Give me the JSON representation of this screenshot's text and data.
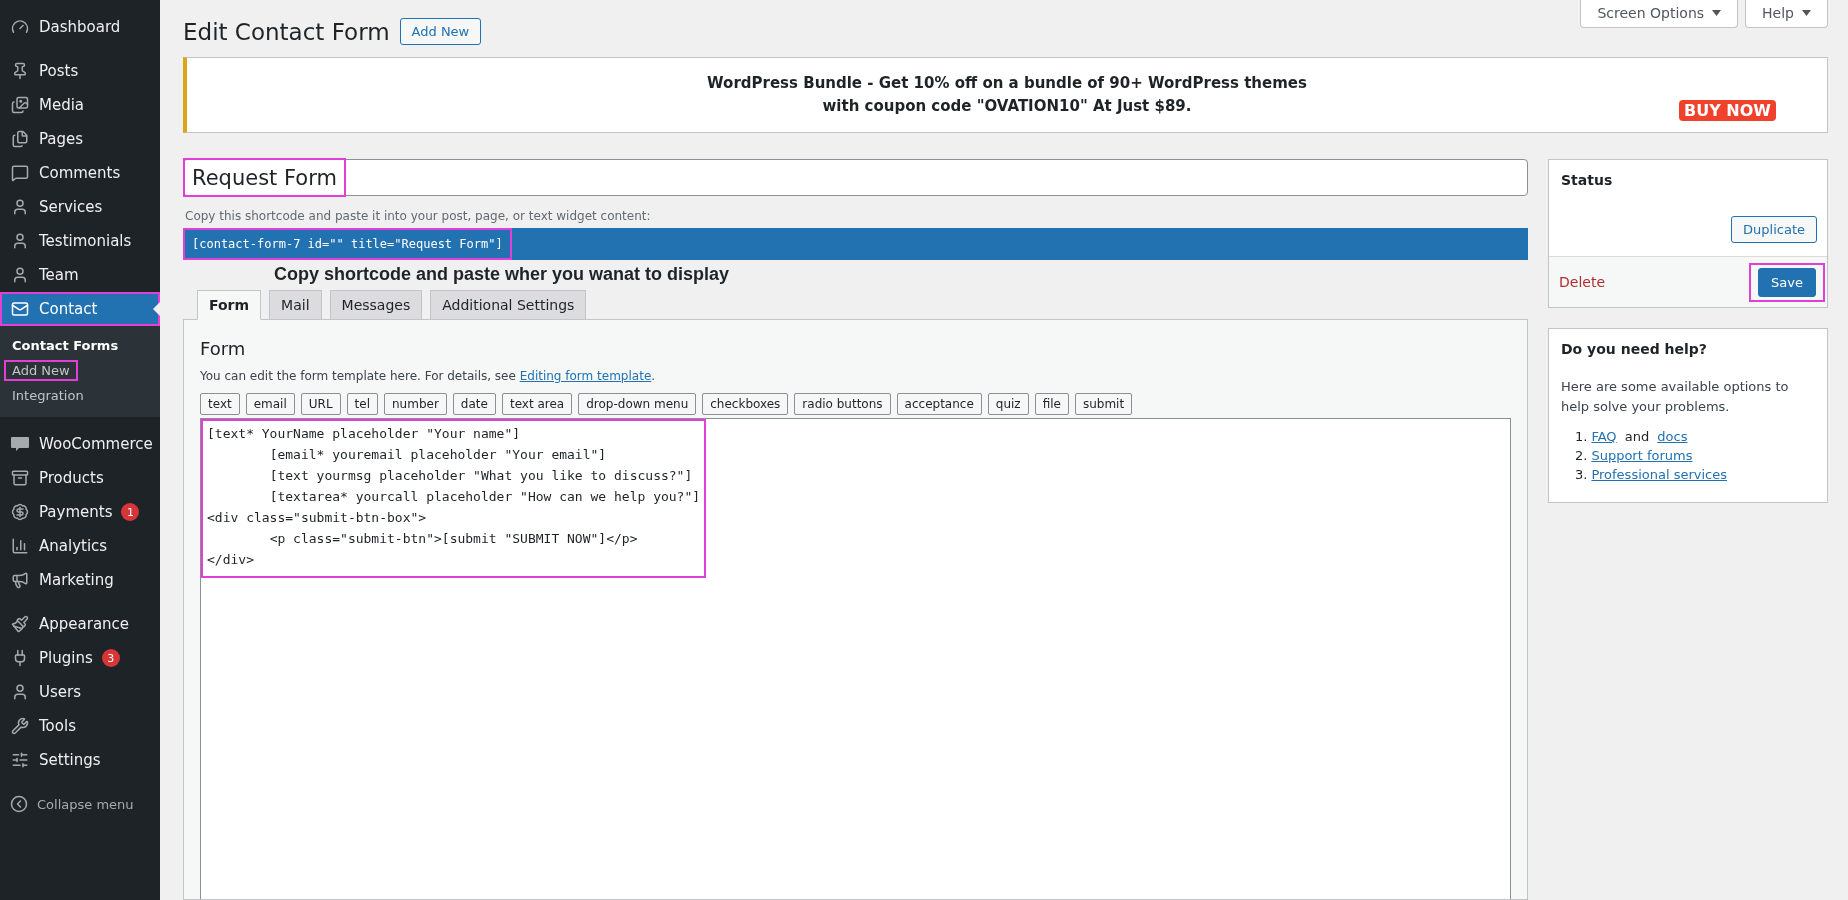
{
  "sidebar": {
    "sections": [
      [
        {
          "label": "Dashboard",
          "selected": false,
          "highlighted": false
        }
      ],
      [
        {
          "label": "Posts",
          "selected": false,
          "highlighted": false
        },
        {
          "label": "Media",
          "selected": false,
          "highlighted": false
        },
        {
          "label": "Pages",
          "selected": false,
          "highlighted": false
        },
        {
          "label": "Comments",
          "selected": false,
          "highlighted": false
        },
        {
          "label": "Services",
          "selected": false,
          "highlighted": false
        },
        {
          "label": "Testimonials",
          "selected": false,
          "highlighted": false
        },
        {
          "label": "Team",
          "selected": false,
          "highlighted": false
        },
        {
          "label": "Contact",
          "selected": true,
          "highlighted": true,
          "children": [
            {
              "label": "Contact Forms",
              "selected": true,
              "highlighted": false
            },
            {
              "label": "Add New",
              "selected": false,
              "highlighted": true
            },
            {
              "label": "Integration",
              "selected": false,
              "highlighted": false
            }
          ]
        }
      ],
      [
        {
          "label": "WooCommerce",
          "selected": false,
          "highlighted": false
        },
        {
          "label": "Products",
          "selected": false,
          "highlighted": false
        },
        {
          "label": "Payments",
          "selected": false,
          "highlighted": false,
          "badge": "1"
        },
        {
          "label": "Analytics",
          "selected": false,
          "highlighted": false
        },
        {
          "label": "Marketing",
          "selected": false,
          "highlighted": false
        }
      ],
      [
        {
          "label": "Appearance",
          "selected": false,
          "highlighted": false
        },
        {
          "label": "Plugins",
          "selected": false,
          "highlighted": false,
          "badge": "3"
        },
        {
          "label": "Users",
          "selected": false,
          "highlighted": false
        },
        {
          "label": "Tools",
          "selected": false,
          "highlighted": false
        },
        {
          "label": "Settings",
          "selected": false,
          "highlighted": false
        }
      ]
    ],
    "collapse": "Collapse menu"
  },
  "top_tabs": [
    "Screen Options",
    "Help"
  ],
  "page_title": "Edit Contact Form",
  "add_new": "Add New",
  "banner": {
    "lines": [
      "WordPress Bundle - Get 10% off on a bundle of 90+ WordPress themes",
      "with coupon code \"OVATION10\" At Just $89."
    ],
    "button": "BUY NOW"
  },
  "title_field": {
    "value": "Request Form",
    "highlighted": true
  },
  "shortcode": {
    "hint": "Copy this shortcode and paste it into your post, page, or text widget content:",
    "code": "[contact-form-7 id=\"\" title=\"Request Form\"]",
    "highlighted": true
  },
  "annotation": "Copy shortcode and paste wher you wanat to display",
  "tabs": [
    {
      "label": "Form",
      "selected": true
    },
    {
      "label": "Mail",
      "selected": false
    },
    {
      "label": "Messages",
      "selected": false
    },
    {
      "label": "Additional Settings",
      "selected": false
    }
  ],
  "form_panel": {
    "heading": "Form",
    "description": [
      {
        "text": "You can edit the form template here. For details, see ",
        "link": false
      },
      {
        "text": "Editing form template",
        "link": true
      },
      {
        "text": ".",
        "link": false
      }
    ],
    "tag_buttons": [
      "text",
      "email",
      "URL",
      "tel",
      "number",
      "date",
      "text area",
      "drop-down menu",
      "checkboxes",
      "radio buttons",
      "acceptance",
      "quiz",
      "file",
      "submit"
    ],
    "code": "[text* YourName placeholder \"Your name\"]\n\t[email* youremail placeholder \"Your email\"]\n\t[text yourmsg placeholder \"What you like to discuss?\"]\n\t[textarea* yourcall placeholder \"How can we help you?\"]\n<div class=\"submit-btn-box\">\n\t<p class=\"submit-btn\">[submit \"SUBMIT NOW\"]</p>\n</div>",
    "code_highlighted": true
  },
  "status_box": {
    "title": "Status",
    "duplicate": "Duplicate",
    "delete": "Delete",
    "save": "Save",
    "save_highlighted": true
  },
  "help_box": {
    "title": "Do you need help?",
    "intro": "Here are some available options to help solve your problems.",
    "items": [
      {
        "number": "1.",
        "parts": [
          {
            "text": "FAQ",
            "link": true
          },
          {
            "text": " and ",
            "link": false
          },
          {
            "text": "docs",
            "link": true
          }
        ]
      },
      {
        "number": "2.",
        "parts": [
          {
            "text": "Support forums",
            "link": true
          }
        ]
      },
      {
        "number": "3.",
        "parts": [
          {
            "text": "Professional services",
            "link": true
          }
        ]
      }
    ]
  }
}
